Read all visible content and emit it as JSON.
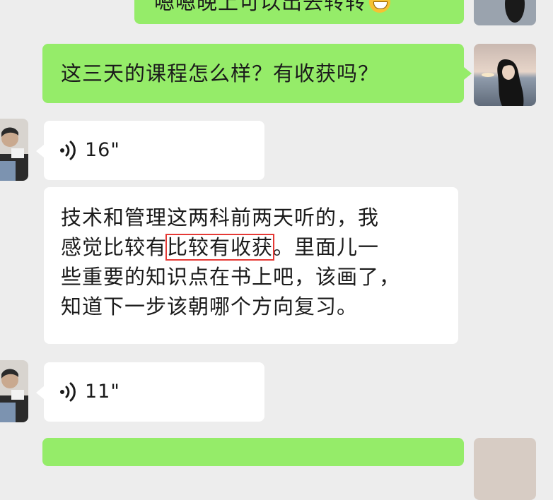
{
  "messages": {
    "m0": {
      "text": "嗯嗯晚上可以出去转转",
      "emoji": "grin-emoji"
    },
    "m1": {
      "text": "这三天的课程怎么样？有收获吗？"
    },
    "m2": {
      "duration": "16\""
    },
    "m3": {
      "line1": "技术和管理这两科前两天听的，我",
      "line2_pre": "感觉比较有",
      "line2_hl": "比较有收获",
      "line2_post": "。里面儿一",
      "line3": "些重要的知识点在书上吧，该画了，",
      "line4": "知道下一步该朝哪个方向复习。"
    },
    "m4": {
      "duration": "11\""
    }
  },
  "colors": {
    "background": "#ededed",
    "sent_bubble": "#95ec69",
    "received_bubble": "#ffffff",
    "highlight_box": "#e53935"
  },
  "icons": {
    "voice": "voice-wave-icon",
    "avatar_self": "avatar-sea-sunset",
    "avatar_other": "avatar-person"
  }
}
